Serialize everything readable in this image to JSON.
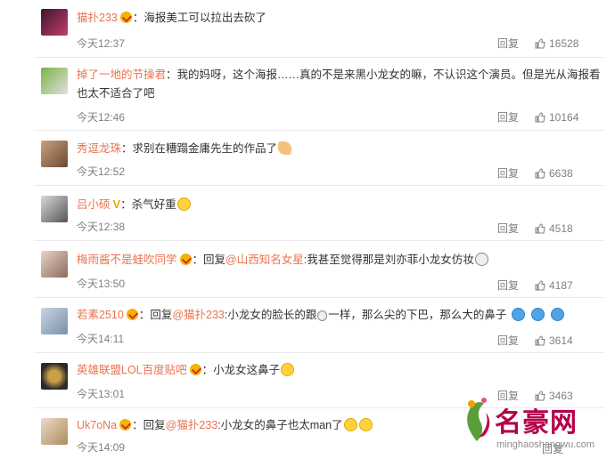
{
  "labels": {
    "reply": "回复"
  },
  "comments": [
    {
      "user": "猫扑233",
      "parts": [
        {
          "t": "：海报美工可以拉出去砍了"
        }
      ],
      "time": "今天12:37",
      "likes": "16528",
      "avatar": [
        "#3a1630",
        "#c43d6a"
      ]
    },
    {
      "user": "掉了一地的节操君",
      "parts": [
        {
          "t": "：我的妈呀，这个海报……真的不是来黑小龙女的嘛，不认识这个演员。但是光从海报看也太不适合了吧"
        }
      ],
      "time": "今天12:46",
      "likes": "10164",
      "avatar": [
        "#7cb342",
        "#e0e0e0"
      ]
    },
    {
      "user": "秀逗龙珠",
      "parts": [
        {
          "t": "：求别在糟蹋金庸先生的作品了"
        }
      ],
      "time": "今天12:52",
      "likes": "6638",
      "avatar": [
        "#c9a27e",
        "#6b4a35"
      ]
    },
    {
      "user": "吕小硕",
      "parts": [
        {
          "t": "：杀气好重"
        }
      ],
      "time": "今天12:38",
      "likes": "4518",
      "avatar": [
        "#d9d9d9",
        "#555555"
      ]
    },
    {
      "user": "梅雨酱不是蛙吹同学",
      "parts": [
        {
          "t": "：回复"
        },
        {
          "m": "@山西知名女星"
        },
        {
          "t": ":我甚至觉得那是刘亦菲小龙女仿妆"
        }
      ],
      "time": "今天13:50",
      "likes": "4187",
      "avatar": [
        "#e8d5c8",
        "#8a6a5a"
      ]
    },
    {
      "user": "若素2510",
      "parts": [
        {
          "t": "：回复"
        },
        {
          "m": "@猫扑233"
        },
        {
          "t": ":小龙女的脸长的跟"
        },
        {
          "t": "一样，那么尖的下巴，那么大的鼻子"
        }
      ],
      "time": "今天14:11",
      "likes": "3614",
      "avatar": [
        "#c8d6e5",
        "#7a8fa6"
      ]
    },
    {
      "user": "英雄联盟LOL百度贴吧",
      "parts": [
        {
          "t": "：小龙女这鼻子"
        }
      ],
      "time": "今天13:01",
      "likes": "3463",
      "avatar": [
        "#2a2a2a",
        "#c9a04a"
      ]
    },
    {
      "user": "Uk7oNa",
      "parts": [
        {
          "t": "：回复"
        },
        {
          "m": "@猫扑233"
        },
        {
          "t": ":小龙女的鼻子也太man了"
        }
      ],
      "time": "今天14:09",
      "likes": "",
      "avatar": [
        "#e9dcc9",
        "#b08a5e"
      ]
    }
  ],
  "watermark": {
    "brand": "名豪网",
    "site": "minghaoshangwu.com"
  }
}
